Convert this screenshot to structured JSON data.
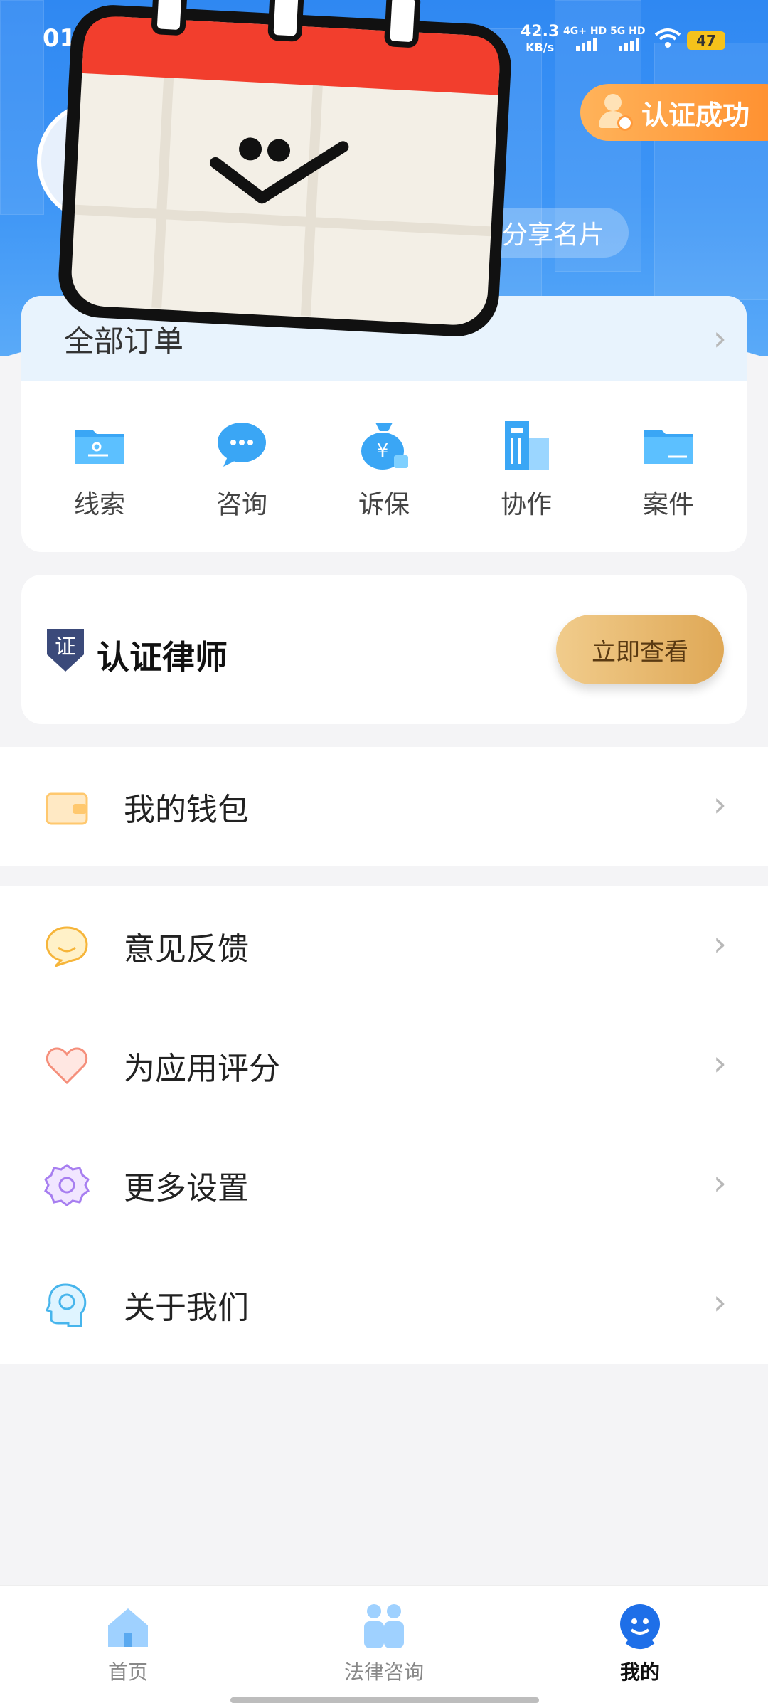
{
  "status_bar": {
    "time": "01",
    "speed_value": "42.3",
    "speed_unit": "KB/s",
    "sim1": "4G+ HD",
    "sim2": "5G HD",
    "battery": "47"
  },
  "profile": {
    "cert_badge": "认证成功",
    "share_button": "分享名片"
  },
  "orders": {
    "title": "全部订单",
    "items": [
      {
        "label": "线索",
        "icon": "folder-icon"
      },
      {
        "label": "咨询",
        "icon": "chat-bubble-icon"
      },
      {
        "label": "诉保",
        "icon": "money-bag-icon"
      },
      {
        "label": "协作",
        "icon": "building-icon"
      },
      {
        "label": "案件",
        "icon": "folder-icon"
      }
    ]
  },
  "lawyer_card": {
    "badge": "证",
    "title": "认证律师",
    "button": "立即查看"
  },
  "menu": {
    "wallet": "我的钱包",
    "feedback": "意见反馈",
    "rate": "为应用评分",
    "settings": "更多设置",
    "about": "关于我们"
  },
  "tabbar": {
    "home": "首页",
    "legal": "法律咨询",
    "mine": "我的"
  },
  "colors": {
    "accent": "#3d95f6",
    "gold": "#e4b266",
    "badge": "#ff9a3c"
  }
}
